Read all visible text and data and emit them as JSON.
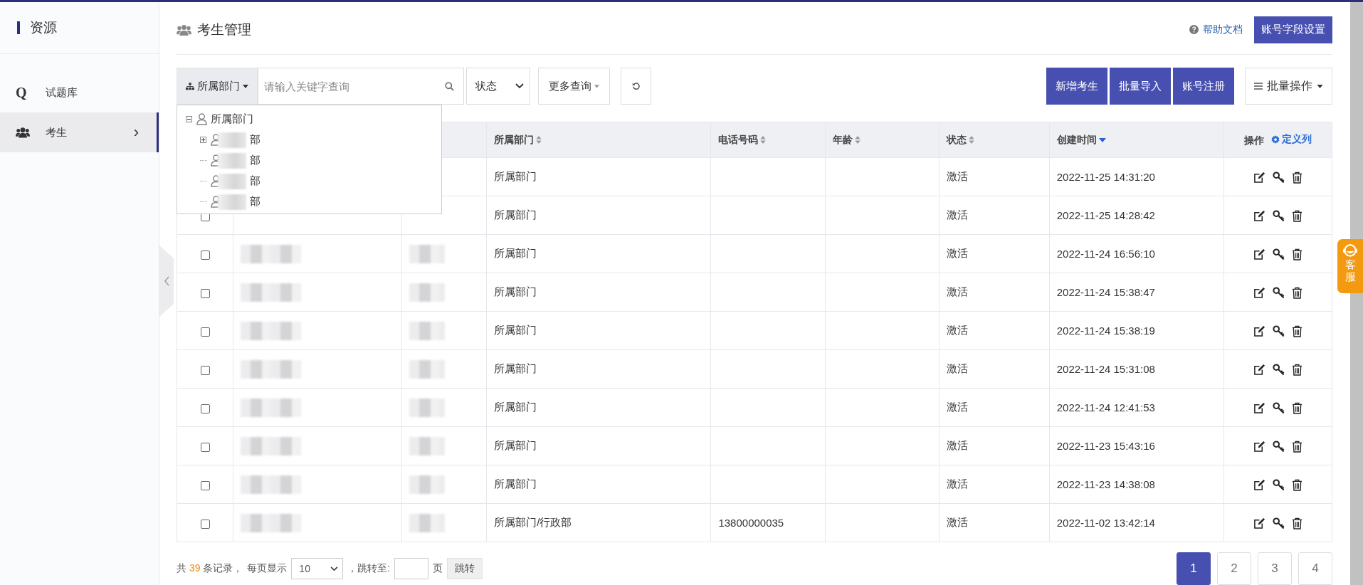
{
  "sidebar": {
    "title": "资源",
    "items": [
      {
        "icon_text": "Q",
        "label": "试题库",
        "selected": false
      },
      {
        "label": "考生",
        "selected": true,
        "arrow": "›"
      }
    ]
  },
  "header": {
    "title": "考生管理",
    "help_link": "帮助文档",
    "settings_button": "账号字段设置"
  },
  "toolbar": {
    "dept_button": "所属部门",
    "search": {
      "placeholder": "请输入关键字查询"
    },
    "status_select": "状态",
    "more_query": "更多查询",
    "actions": [
      "新增考生",
      "批量导入",
      "账号注册"
    ],
    "batch": "批量操作"
  },
  "dept_dropdown": {
    "root": {
      "label": "所属部门",
      "expanded": true,
      "children": [
        {
          "label": "部",
          "kind": "branch",
          "expanded": false
        },
        {
          "label": "部",
          "kind": "leaf"
        },
        {
          "label": "部",
          "kind": "leaf"
        },
        {
          "label": "部",
          "kind": "leaf"
        }
      ]
    }
  },
  "table": {
    "columns": [
      {
        "label": "所属部门",
        "sortable": true,
        "sorted": false
      },
      {
        "label": "电话号码",
        "sortable": true,
        "sorted": false
      },
      {
        "label": "年龄",
        "sortable": true,
        "sorted": false
      },
      {
        "label": "状态",
        "sortable": true,
        "sorted": false
      },
      {
        "label": "创建时间",
        "sortable": true,
        "sorted": true
      },
      {
        "label": "操作",
        "sortable": false,
        "link": "定义列"
      }
    ],
    "rows": [
      {
        "redacted": false,
        "department": "所属部门",
        "status": "激活",
        "created": "2022-11-25 14:31:20"
      },
      {
        "checked": false,
        "redacted": false,
        "department": "所属部门",
        "status": "激活",
        "created": "2022-11-25 14:28:42"
      },
      {
        "checked": false,
        "redacted": true,
        "department": "所属部门",
        "status": "激活",
        "created": "2022-11-24 16:56:10"
      },
      {
        "checked": false,
        "redacted": true,
        "department": "所属部门",
        "status": "激活",
        "created": "2022-11-24 15:38:47"
      },
      {
        "checked": false,
        "redacted": true,
        "department": "所属部门",
        "status": "激活",
        "created": "2022-11-24 15:38:19"
      },
      {
        "checked": false,
        "redacted": true,
        "department": "所属部门",
        "status": "激活",
        "created": "2022-11-24 15:31:08"
      },
      {
        "checked": false,
        "redacted": true,
        "department": "所属部门",
        "status": "激活",
        "created": "2022-11-24 12:41:53"
      },
      {
        "checked": false,
        "redacted": true,
        "department": "所属部门",
        "status": "激活",
        "created": "2022-11-23 15:43:16"
      },
      {
        "checked": false,
        "redacted": true,
        "department": "所属部门",
        "status": "激活",
        "created": "2022-11-23 14:38:08"
      },
      {
        "checked": false,
        "redacted": true,
        "department": "所属部门/行政部",
        "phone": "13800000035",
        "status": "激活",
        "created": "2022-11-02 13:42:14"
      }
    ]
  },
  "footer": {
    "prefix": "共",
    "count": "39",
    "suffix": "条记录，",
    "page_size_label": "每页显示",
    "page_size": "10",
    "jump_label": "，跳转至:",
    "page_unit": "页",
    "jump_button": "跳转",
    "pages": [
      {
        "label": "1",
        "selected": true
      },
      {
        "label": "2",
        "selected": false
      },
      {
        "label": "3",
        "selected": false
      },
      {
        "label": "4",
        "selected": false
      }
    ]
  },
  "support_tab": "客服"
}
